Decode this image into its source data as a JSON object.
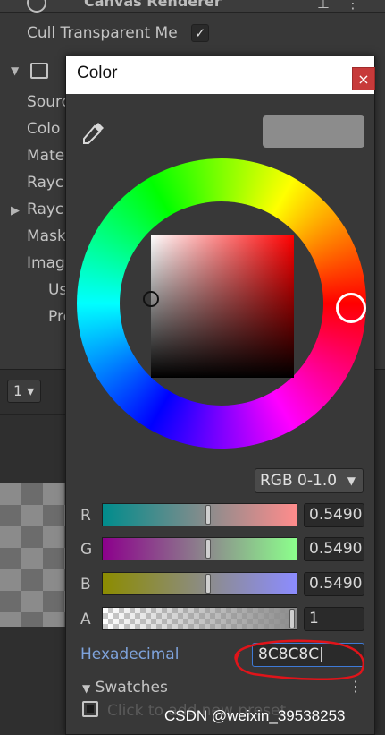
{
  "inspector": {
    "component_title": "Canvas Renderer",
    "cull_label": "Cull Transparent Me",
    "cull_checked": "✓",
    "image_checked": "✓",
    "rows": [
      "Sourc",
      "Colo",
      "Mate",
      "Rayc",
      "Rayc",
      "Mask",
      "Imag",
      "Us",
      "Pre"
    ],
    "lower_dropdown": "1"
  },
  "picker": {
    "title": "Color",
    "close": "×",
    "preview_color": "#8c8c8c",
    "mode": "RGB 0-1.0",
    "channels": [
      {
        "label": "R",
        "value": "0.5490",
        "fraction": 0.549
      },
      {
        "label": "G",
        "value": "0.5490",
        "fraction": 0.549
      },
      {
        "label": "B",
        "value": "0.5490",
        "fraction": 0.549
      },
      {
        "label": "A",
        "value": "1",
        "fraction": 1.0
      }
    ],
    "hex_label": "Hexadecimal",
    "hex_value": "8C8C8C",
    "swatches_label": "Swatches",
    "kebab": "⋮",
    "preset_hint": "Click to add new preset"
  },
  "watermark": "CSDN @weixin_39538253"
}
